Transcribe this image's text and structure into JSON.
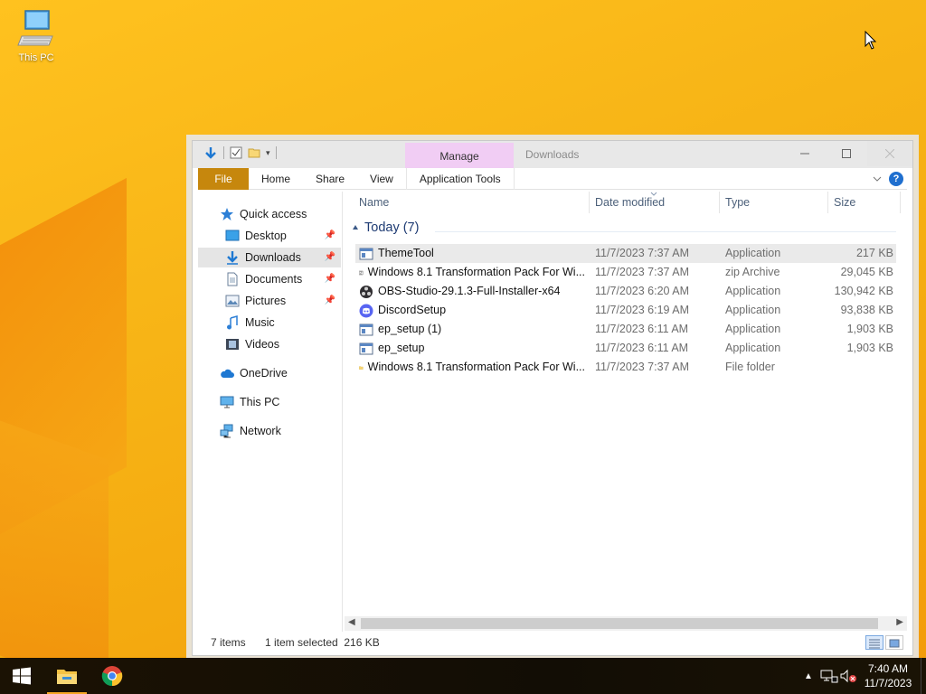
{
  "desktop": {
    "icons": [
      {
        "label": "This PC",
        "icon": "this-pc-icon"
      }
    ]
  },
  "window": {
    "title": "Downloads",
    "context_tab": "Manage",
    "ribbon_tabs": [
      "File",
      "Home",
      "Share",
      "View",
      "Application Tools"
    ],
    "help_label": "?",
    "nav": {
      "quick_access": "Quick access",
      "items": [
        "Desktop",
        "Downloads",
        "Documents",
        "Pictures",
        "Music",
        "Videos"
      ],
      "onedrive": "OneDrive",
      "this_pc": "This PC",
      "network": "Network",
      "selected": "Downloads"
    },
    "columns": [
      "Name",
      "Date modified",
      "Type",
      "Size"
    ],
    "group": {
      "label": "Today (7)"
    },
    "files": [
      {
        "name": "ThemeTool",
        "date": "11/7/2023 7:37 AM",
        "type": "Application",
        "size": "217 KB",
        "icon": "application-icon",
        "selected": true
      },
      {
        "name": "Windows 8.1 Transformation Pack For Wi...",
        "date": "11/7/2023 7:37 AM",
        "type": "zip Archive",
        "size": "29,045 KB",
        "icon": "zip-archive-icon"
      },
      {
        "name": "OBS-Studio-29.1.3-Full-Installer-x64",
        "date": "11/7/2023 6:20 AM",
        "type": "Application",
        "size": "130,942 KB",
        "icon": "obs-icon"
      },
      {
        "name": "DiscordSetup",
        "date": "11/7/2023 6:19 AM",
        "type": "Application",
        "size": "93,838 KB",
        "icon": "discord-icon"
      },
      {
        "name": "ep_setup (1)",
        "date": "11/7/2023 6:11 AM",
        "type": "Application",
        "size": "1,903 KB",
        "icon": "application-icon"
      },
      {
        "name": "ep_setup",
        "date": "11/7/2023 6:11 AM",
        "type": "Application",
        "size": "1,903 KB",
        "icon": "application-icon"
      },
      {
        "name": "Windows 8.1 Transformation Pack For Wi...",
        "date": "11/7/2023 7:37 AM",
        "type": "File folder",
        "size": "",
        "icon": "folder-icon"
      }
    ],
    "status": {
      "count": "7 items",
      "selection": "1 item selected  216 KB"
    }
  },
  "taskbar": {
    "time": "7:40 AM",
    "date": "11/7/2023",
    "apps": [
      "start-icon",
      "file-explorer-icon",
      "chrome-icon"
    ]
  },
  "colors": {
    "file_tab": "#c6870d",
    "manage_tab": "#f1cdf4",
    "accent": "#1f6fcf"
  }
}
